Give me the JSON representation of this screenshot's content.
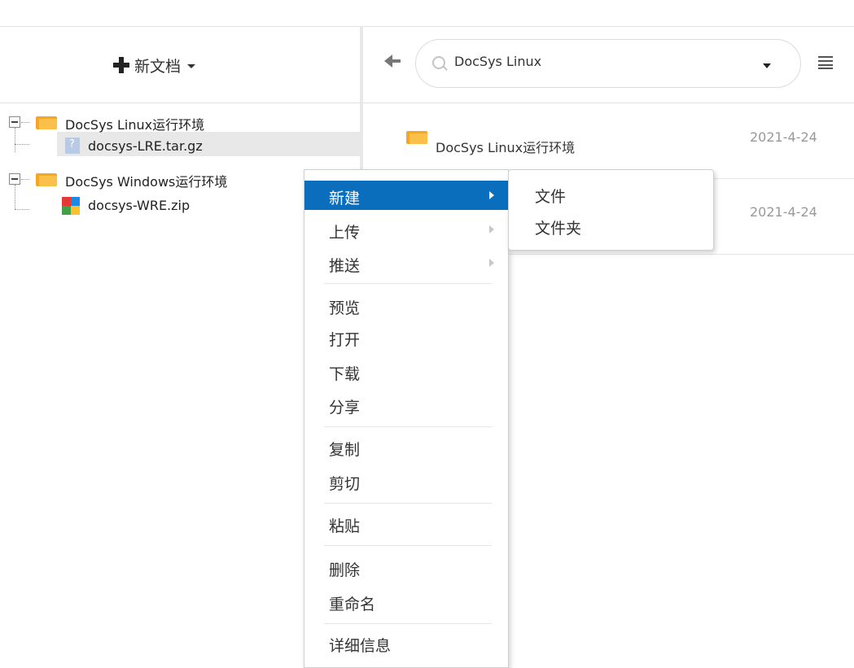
{
  "toolbar": {
    "new_doc_label": "新文档"
  },
  "tree": {
    "items": [
      {
        "label": "DocSys Linux运行环境",
        "type": "folder"
      },
      {
        "label": "docsys-LRE.tar.gz",
        "type": "file-unknown"
      },
      {
        "label": "DocSys Windows运行环境",
        "type": "folder"
      },
      {
        "label": "docsys-WRE.zip",
        "type": "zip"
      }
    ]
  },
  "search": {
    "value": "DocSys Linux"
  },
  "files": [
    {
      "name": "DocSys Linux运行环境",
      "date": "2021-4-24"
    },
    {
      "name": "",
      "date": "2021-4-24"
    }
  ],
  "context_menu": {
    "items": {
      "new": "新建",
      "upload": "上传",
      "push": "推送",
      "preview": "预览",
      "open": "打开",
      "download": "下载",
      "share": "分享",
      "copy": "复制",
      "cut": "剪切",
      "paste": "粘贴",
      "delete": "删除",
      "rename": "重命名",
      "details": "详细信息"
    }
  },
  "submenu": {
    "file": "文件",
    "folder": "文件夹"
  },
  "colors": {
    "menu_active": "#0a6ebd",
    "folder": "#f5a623"
  }
}
